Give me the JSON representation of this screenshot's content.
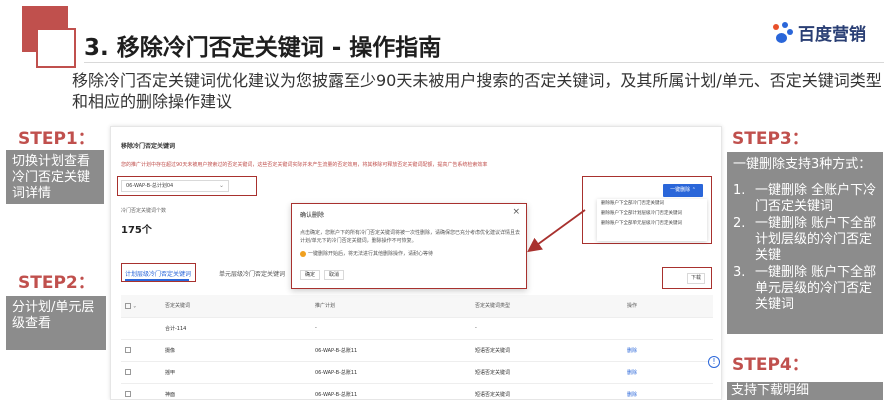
{
  "header": {
    "title": "3. 移除冷门否定关键词 - 操作指南",
    "logo_text": "百度营销",
    "description": "移除冷门否定关键词优化建议为您披露至少90天未被用户搜索的否定关键词，及其所属计划/单元、否定关键词类型和相应的删除操作建议"
  },
  "steps": {
    "step1": {
      "label": "STEP1：",
      "text": "切换计划查看冷门否定关键词详情"
    },
    "step2": {
      "label": "STEP2：",
      "text": "分计划/单元层级查看"
    },
    "step3": {
      "label": "STEP3：",
      "heading": "一键删除支持3种方式：",
      "items": [
        {
          "num": "1.",
          "text": "一键删除 全账户下冷门否定关键词"
        },
        {
          "num": "2.",
          "text": "一键删除 账户下全部计划层级的冷门否定关键"
        },
        {
          "num": "3.",
          "text": "一键删除 账户下全部单元层级的冷门否定关键词"
        }
      ]
    },
    "step4": {
      "label": "STEP4：",
      "text": "支持下载明细"
    }
  },
  "panel": {
    "title": "移除冷门否定关键词",
    "hint": "您的推广计划中存在超过90天未被用户搜索过的否定关键词，这些否定关键词实际并未产生流量的否定效用，将其移除可释放否定关键词配额，提高广告系统检索效率",
    "plan_select": "06-WAP-B-总计划04",
    "count_label": "冷门否定关键词个数",
    "count_value": "175个",
    "one_click_button": "一键删除",
    "menu": [
      "删除账户下全部冷门否定关键词",
      "删除账户下全部计划层级冷门否定关键词",
      "删除账户下全部单元层级冷门否定关键词"
    ],
    "tabs": {
      "active": "计划层级冷门否定关键词",
      "other": "单元层级冷门否定关键词",
      "other2": ""
    },
    "download_button": "下载",
    "table": {
      "headers": [
        "",
        "否定关键词",
        "推广计划",
        "否定关键词类型",
        "操作"
      ],
      "rows": [
        {
          "keyword": "合计-114",
          "plan": "-",
          "type": "-",
          "action": ""
        },
        {
          "keyword": "摄像",
          "plan": "06-WAP-B-总账11",
          "type": "短语否定关键词",
          "action": "删除"
        },
        {
          "keyword": "摇甲",
          "plan": "06-WAP-B-总账11",
          "type": "短语否定关键词",
          "action": "删除"
        },
        {
          "keyword": "神面",
          "plan": "06-WAP-B-总账11",
          "type": "短语否定关键词",
          "action": "删除"
        }
      ]
    },
    "modal": {
      "title": "确认删除",
      "body": "点击确定，您账户下的所有冷门否定关键词将被一次性删除，请确保您已充分考虑优化建议详情且去计划/单元下的冷门否定关键词，删除操作不可恢复。",
      "warning": "一键删除开始后，将无法进行其他删除操作，请耐心等待",
      "ok": "确定",
      "cancel": "取消"
    }
  },
  "colors": {
    "accent_red": "#c0504d",
    "box_grey": "#8c8c8c",
    "link_blue": "#2a66d9"
  }
}
